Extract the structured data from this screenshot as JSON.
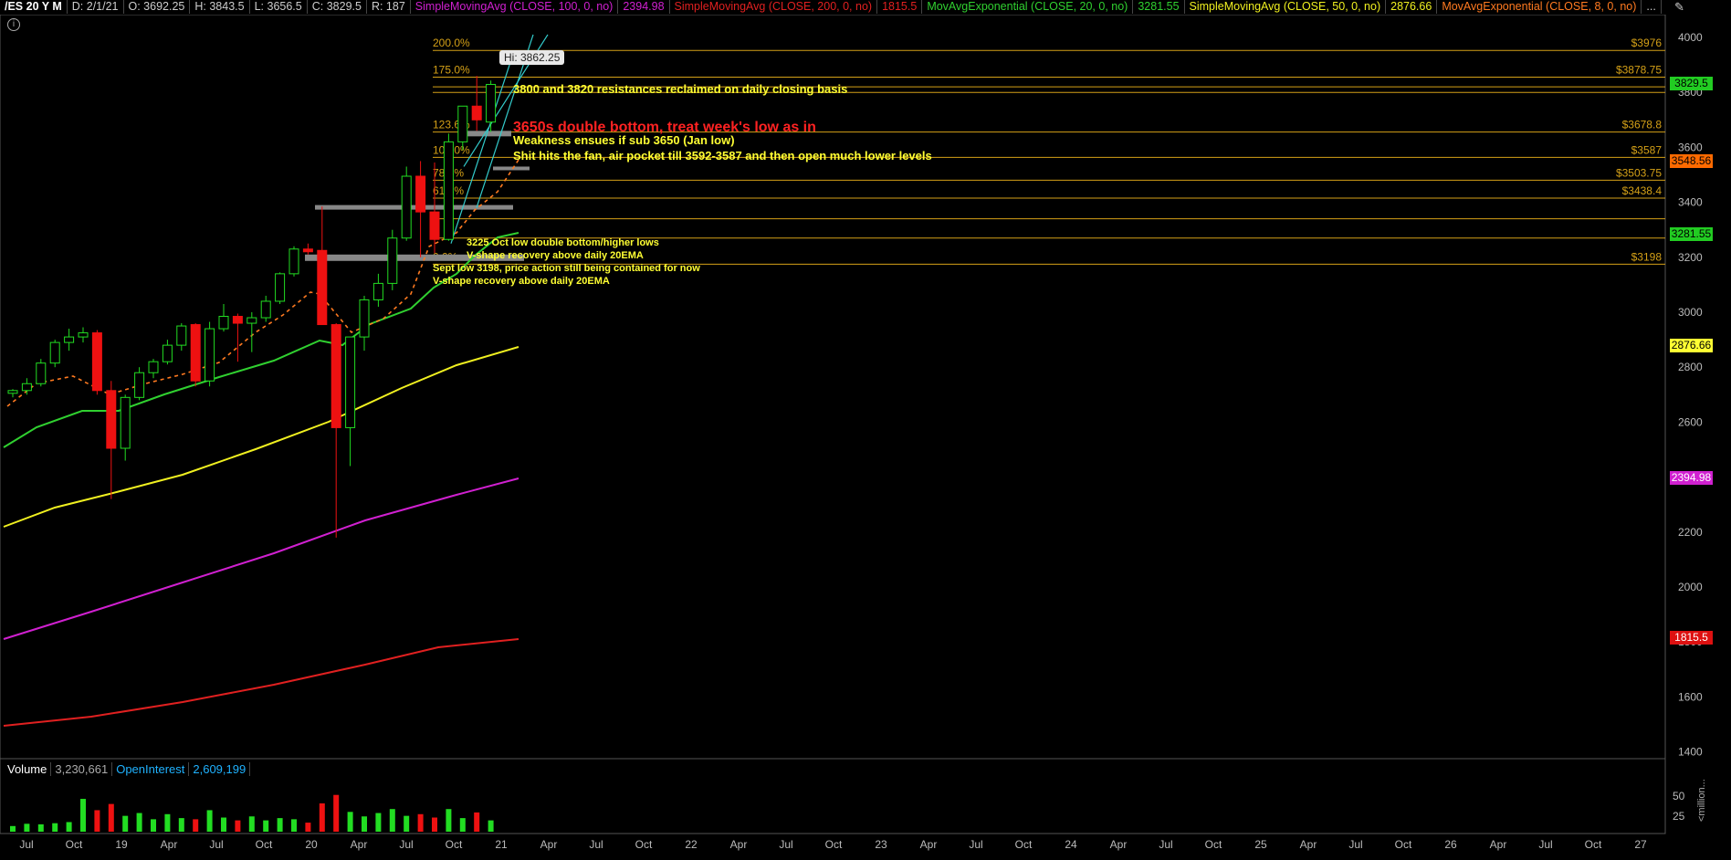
{
  "header": {
    "symbol": "/ES 20 Y M",
    "date": "D: 2/1/21",
    "open": "O: 3692.25",
    "high": "H: 3843.5",
    "low": "L: 3656.5",
    "close": "C: 3829.5",
    "range": "R: 187",
    "studies": [
      {
        "label": "SimpleMovingAvg (CLOSE, 100, 0, no)",
        "value": "2394.98",
        "color": "#d020d0"
      },
      {
        "label": "SimpleMovingAvg (CLOSE, 200, 0, no)",
        "value": "1815.5",
        "color": "#e02020"
      },
      {
        "label": "MovAvgExponential (CLOSE, 20, 0, no)",
        "value": "3281.55",
        "color": "#30d030"
      },
      {
        "label": "SimpleMovingAvg (CLOSE, 50, 0, no)",
        "value": "2876.66",
        "color": "#f0f020"
      },
      {
        "label": "MovAvgExponential (CLOSE, 8, 0, no)",
        "value": "",
        "color": "#ff7a20"
      }
    ],
    "more": "..."
  },
  "fib": {
    "levels": [
      {
        "pct": "200.0%",
        "price": "$3976"
      },
      {
        "pct": "175.0%",
        "price": "$3878.75"
      },
      {
        "pct": "123.6%",
        "price": "$3678.8"
      },
      {
        "pct": "100.0%",
        "price": "$3587"
      },
      {
        "pct": "78.6%",
        "price": "$3503.75"
      },
      {
        "pct": "61.8%",
        "price": "$3438.4"
      },
      {
        "pct": "0.0%",
        "price": "$3198"
      }
    ]
  },
  "hi_label": "Hi: 3862.25",
  "annotations": {
    "a1": "3800 and 3820 resistances reclaimed on daily closing basis",
    "a2": "3650s double bottom, treat week's low as in",
    "a3": "Weakness ensues if sub 3650 (Jan low)",
    "a4": "Shit hits the fan, air pocket till 3592-3587 and then open much lower levels",
    "a5": "3225 Oct low double bottom/higher lows",
    "a6": "V-shape recovery above daily 20EMA",
    "a7": "Sept low 3198, price action still being contained for now",
    "a8": "V-shape recovery above daily 20EMA"
  },
  "price_axis": {
    "ticks": [
      "4000",
      "3800",
      "3600",
      "3400",
      "3200",
      "3000",
      "2800",
      "2600",
      "2400",
      "2200",
      "2000",
      "1800",
      "1600",
      "1400"
    ],
    "labels": [
      {
        "value": "3829.5",
        "bg": "#22cc22",
        "fg": "#000"
      },
      {
        "value": "3548.56",
        "bg": "#ff6a00",
        "fg": "#000"
      },
      {
        "value": "3281.55",
        "bg": "#22cc22",
        "fg": "#000"
      },
      {
        "value": "2876.66",
        "bg": "#ffff33",
        "fg": "#000"
      },
      {
        "value": "2394.98",
        "bg": "#d020d0",
        "fg": "#fff"
      },
      {
        "value": "1815.5",
        "bg": "#dd1111",
        "fg": "#fff"
      }
    ]
  },
  "volume": {
    "label": "Volume",
    "value": "3,230,661",
    "oi_label": "OpenInterest",
    "oi_value": "2,609,199",
    "ticks": [
      "50",
      "25"
    ],
    "unit": "<million..."
  },
  "time_axis": [
    "Jul",
    "Oct",
    "19",
    "Apr",
    "Jul",
    "Oct",
    "20",
    "Apr",
    "Jul",
    "Oct",
    "21",
    "Apr",
    "Jul",
    "Oct",
    "22",
    "Apr",
    "Jul",
    "Oct",
    "23",
    "Apr",
    "Jul",
    "Oct",
    "24",
    "Apr",
    "Jul",
    "Oct",
    "25",
    "Apr",
    "Jul",
    "Oct",
    "26",
    "Apr",
    "Jul",
    "Oct",
    "27"
  ],
  "chart_data": {
    "type": "candlestick",
    "title": "/ES 20 Y M",
    "ylim": [
      1400,
      4050
    ],
    "bars": [
      {
        "o": 2705,
        "h": 2720,
        "l": 2690,
        "c": 2715
      },
      {
        "o": 2715,
        "h": 2760,
        "l": 2700,
        "c": 2740
      },
      {
        "o": 2740,
        "h": 2830,
        "l": 2730,
        "c": 2815
      },
      {
        "o": 2815,
        "h": 2900,
        "l": 2800,
        "c": 2890
      },
      {
        "o": 2890,
        "h": 2940,
        "l": 2860,
        "c": 2910
      },
      {
        "o": 2910,
        "h": 2945,
        "l": 2890,
        "c": 2925
      },
      {
        "o": 2925,
        "h": 2935,
        "l": 2700,
        "c": 2715
      },
      {
        "o": 2715,
        "h": 2750,
        "l": 2320,
        "c": 2505
      },
      {
        "o": 2505,
        "h": 2700,
        "l": 2460,
        "c": 2690
      },
      {
        "o": 2690,
        "h": 2800,
        "l": 2680,
        "c": 2780
      },
      {
        "o": 2780,
        "h": 2830,
        "l": 2760,
        "c": 2820
      },
      {
        "o": 2820,
        "h": 2900,
        "l": 2810,
        "c": 2880
      },
      {
        "o": 2880,
        "h": 2960,
        "l": 2860,
        "c": 2950
      },
      {
        "o": 2955,
        "h": 2960,
        "l": 2730,
        "c": 2750
      },
      {
        "o": 2750,
        "h": 2965,
        "l": 2730,
        "c": 2940
      },
      {
        "o": 2940,
        "h": 3030,
        "l": 2930,
        "c": 2985
      },
      {
        "o": 2985,
        "h": 2995,
        "l": 2820,
        "c": 2960
      },
      {
        "o": 2960,
        "h": 3000,
        "l": 2855,
        "c": 2980
      },
      {
        "o": 2980,
        "h": 3060,
        "l": 2965,
        "c": 3040
      },
      {
        "o": 3040,
        "h": 3145,
        "l": 3030,
        "c": 3140
      },
      {
        "o": 3140,
        "h": 3240,
        "l": 3130,
        "c": 3230
      },
      {
        "o": 3230,
        "h": 3250,
        "l": 3210,
        "c": 3220
      },
      {
        "o": 3225,
        "h": 3385,
        "l": 2960,
        "c": 2955
      },
      {
        "o": 2955,
        "h": 2960,
        "l": 2180,
        "c": 2580
      },
      {
        "o": 2580,
        "h": 2900,
        "l": 2440,
        "c": 2910
      },
      {
        "o": 2910,
        "h": 3060,
        "l": 2860,
        "c": 3045
      },
      {
        "o": 3045,
        "h": 3140,
        "l": 3020,
        "c": 3105
      },
      {
        "o": 3105,
        "h": 3300,
        "l": 3080,
        "c": 3270
      },
      {
        "o": 3270,
        "h": 3530,
        "l": 3260,
        "c": 3495
      },
      {
        "o": 3495,
        "h": 3550,
        "l": 3200,
        "c": 3365
      },
      {
        "o": 3365,
        "h": 3545,
        "l": 3215,
        "c": 3265
      },
      {
        "o": 3265,
        "h": 3650,
        "l": 3260,
        "c": 3620
      },
      {
        "o": 3620,
        "h": 3720,
        "l": 3590,
        "c": 3750
      },
      {
        "o": 3750,
        "h": 3860,
        "l": 3660,
        "c": 3700
      },
      {
        "o": 3692,
        "h": 3843,
        "l": 3656,
        "c": 3829
      }
    ],
    "volume": [
      10,
      14,
      13,
      15,
      17,
      58,
      38,
      49,
      28,
      33,
      22,
      31,
      24,
      22,
      38,
      25,
      20,
      27,
      20,
      24,
      22,
      16,
      50,
      65,
      35,
      27,
      33,
      40,
      28,
      31,
      25,
      40,
      24,
      34,
      20
    ]
  }
}
